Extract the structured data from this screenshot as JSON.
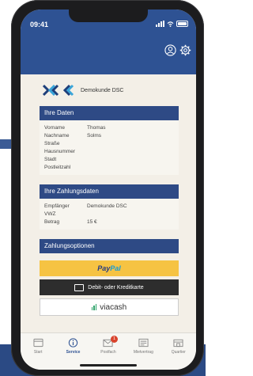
{
  "status_bar": {
    "time": "09:41"
  },
  "merchant": {
    "name": "Demokunde DSC"
  },
  "personal": {
    "title": "Ihre Daten",
    "fields": [
      {
        "label": "Vorname",
        "value": "Thomas"
      },
      {
        "label": "Nachname",
        "value": "Solms"
      },
      {
        "label": "Straße",
        "value": ""
      },
      {
        "label": "Hausnummer",
        "value": ""
      },
      {
        "label": "Stadt",
        "value": ""
      },
      {
        "label": "Postleitzahl",
        "value": ""
      }
    ]
  },
  "payment": {
    "title": "Ihre Zahlungsdaten",
    "fields": [
      {
        "label": "Empfänger",
        "value": "Demokunde DSC"
      },
      {
        "label": "VWZ",
        "value": ""
      },
      {
        "label": "Betrag",
        "value": "15 €"
      }
    ]
  },
  "options": {
    "title": "Zahlungsoptionen",
    "paypal_part1": "Pay",
    "paypal_part2": "Pal",
    "card_label": "Debit- oder Kreditkarte",
    "viacash_label": "viacash"
  },
  "tabs": [
    {
      "label": "Start",
      "icon": "start-icon"
    },
    {
      "label": "Service",
      "icon": "info-icon",
      "active": true
    },
    {
      "label": "Postfach",
      "icon": "mail-icon",
      "badge": "1"
    },
    {
      "label": "Mietvertrag",
      "icon": "contract-icon"
    },
    {
      "label": "Quartier",
      "icon": "building-icon"
    }
  ],
  "colors": {
    "header": "#2e5293",
    "section_header": "#2e4a85",
    "paypal": "#f6c343",
    "badge": "#d9432c"
  }
}
